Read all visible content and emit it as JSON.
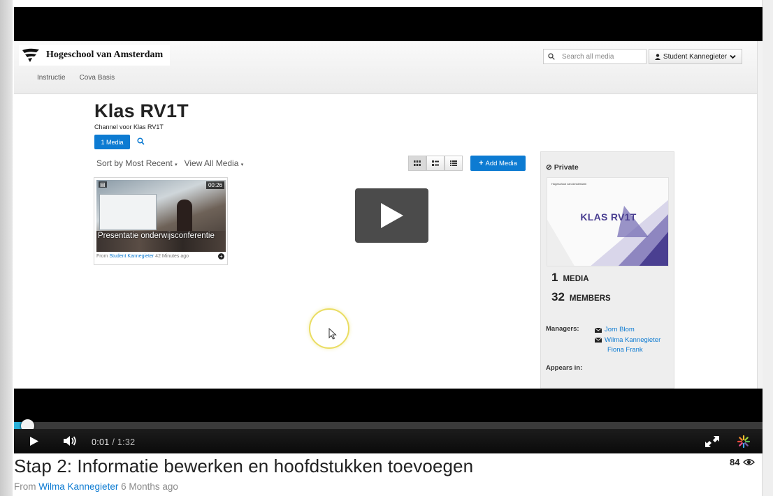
{
  "header": {
    "logo_text": "Hogeschool van Amsterdam",
    "search_placeholder": "Search all media",
    "user_label": "Student Kannegieter"
  },
  "nav": {
    "items": [
      "Instructie",
      "Cova Basis"
    ]
  },
  "channel": {
    "title": "Klas RV1T",
    "subtitle": "Channel voor Klas RV1T",
    "media_button": "1 Media"
  },
  "toolbar": {
    "sort_label": "Sort by Most Recent",
    "view_label": "View All Media",
    "add_media_label": "Add Media"
  },
  "media_item": {
    "duration": "00:26",
    "title": "Presentatie onderwijsconferentie",
    "from_prefix": "From",
    "author": "Student Kannegieter",
    "time_ago": "42 Minutes ago"
  },
  "sidebar": {
    "privacy": "Private",
    "thumb_title": "KLAS RV1T",
    "thumb_logo": "Hogeschool van Amsterdam",
    "media_count": "1",
    "media_label": "MEDIA",
    "members_count": "32",
    "members_label": "MEMBERS",
    "managers_label": "Managers:",
    "managers": [
      "Jorn Blom",
      "Wilma Kannegieter",
      "Fiona Frank"
    ],
    "appears_label": "Appears in:"
  },
  "player": {
    "current_time": "0:01",
    "duration": "/ 1:32",
    "progress_fraction": 0.011
  },
  "video": {
    "title": "Stap 2: Informatie bewerken en hoofdstukken toevoegen",
    "views": "84",
    "from_prefix": "From",
    "author": "Wilma Kannegieter",
    "time_ago": "6 Months ago"
  },
  "colors": {
    "accent": "#0d7bd2",
    "progress": "#2ab0d8",
    "channel_thumb_title": "#4a3f91"
  }
}
